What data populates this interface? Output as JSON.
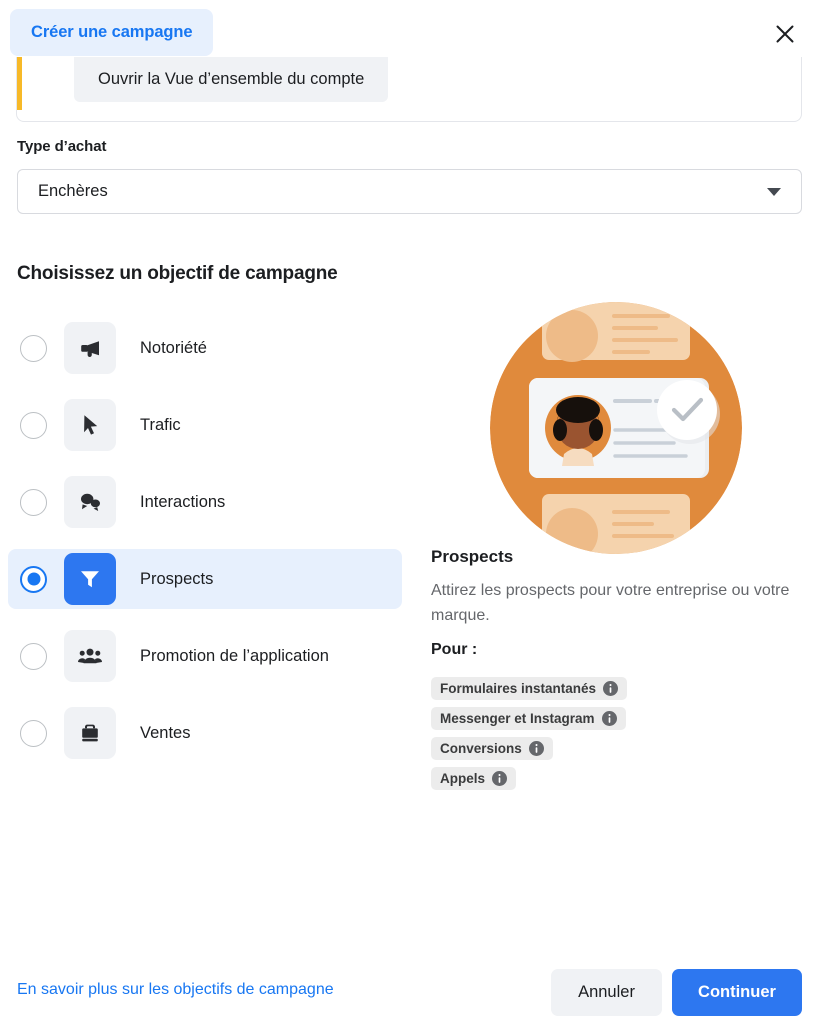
{
  "header": {
    "tab_label": "Créer une campagne",
    "close_icon": "close-icon"
  },
  "notice": {
    "button_label": "Ouvrir la Vue d’ensemble du compte",
    "accent_color": "#f7b928"
  },
  "purchase_type": {
    "label": "Type d’achat",
    "value": "Enchères",
    "caret_icon": "chevron-down-icon"
  },
  "objectives": {
    "section_title": "Choisissez un objectif de campagne",
    "items": [
      {
        "label": "Notoriété",
        "icon": "megaphone-icon",
        "selected": false
      },
      {
        "label": "Trafic",
        "icon": "cursor-arrow-icon",
        "selected": false
      },
      {
        "label": "Interactions",
        "icon": "speech-bubbles-icon",
        "selected": false
      },
      {
        "label": "Prospects",
        "icon": "funnel-icon",
        "selected": true
      },
      {
        "label": "Promotion de l’application",
        "icon": "people-group-icon",
        "selected": false
      },
      {
        "label": "Ventes",
        "icon": "briefcase-icon",
        "selected": false
      }
    ]
  },
  "detail": {
    "illustration": "lead-profile-card-illustration",
    "title": "Prospects",
    "description": "Attirez les prospects pour votre entreprise ou votre marque.",
    "for_label": "Pour :",
    "tags": [
      {
        "label": "Formulaires instantanés",
        "icon": "info-icon"
      },
      {
        "label": "Messenger et Instagram",
        "icon": "info-icon"
      },
      {
        "label": "Conversions",
        "icon": "info-icon"
      },
      {
        "label": "Appels",
        "icon": "info-icon"
      }
    ]
  },
  "footer": {
    "learn_more": "En savoir plus sur les objectifs de campagne",
    "cancel": "Annuler",
    "continue": "Continuer"
  },
  "colors": {
    "accent_blue": "#1877f2",
    "button_blue": "#2d77f0",
    "tab_blue_bg": "#e7f0fd",
    "notice_yellow": "#f7b928",
    "illustration_orange": "#e08a3c"
  }
}
